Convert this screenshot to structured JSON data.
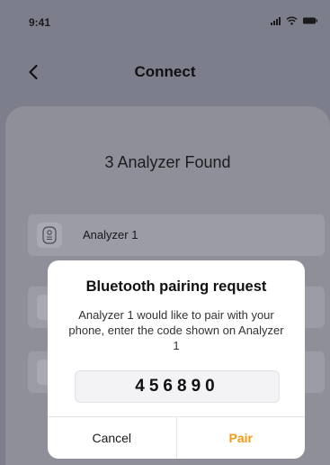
{
  "status_bar": {
    "time": "9:41",
    "icons": [
      "signal-icon",
      "wifi-icon",
      "battery-icon"
    ]
  },
  "nav": {
    "back_icon": "chevron-left-icon",
    "title": "Connect"
  },
  "sheet": {
    "title": "3 Analyzer Found",
    "devices": [
      {
        "label": "Analyzer 1",
        "icon": "analyzer-device-icon"
      }
    ]
  },
  "dialog": {
    "title": "Bluetooth pairing request",
    "message": "Analyzer 1 would like to pair with your phone, enter the code shown on Analyzer 1",
    "code": "456890",
    "cancel_label": "Cancel",
    "pair_label": "Pair"
  },
  "colors": {
    "accent": "#f09a16",
    "overlay": "#7d7e8b"
  }
}
